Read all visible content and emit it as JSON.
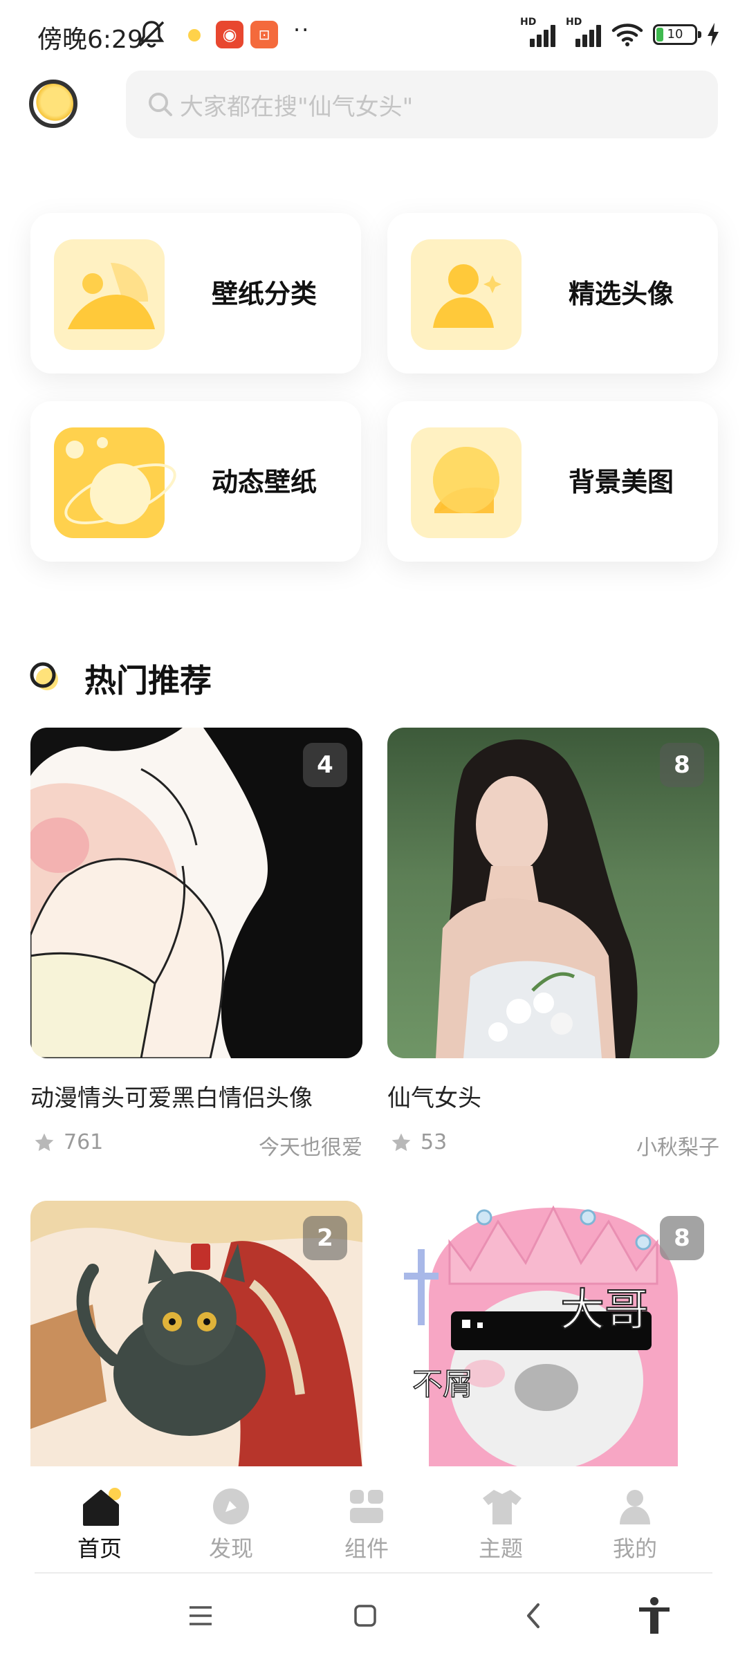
{
  "status_bar": {
    "time": "傍晚6:29",
    "dots": "··",
    "battery": "10",
    "signal_label_1": "HD",
    "signal_label_2": "HD"
  },
  "search": {
    "placeholder": "大家都在搜\"仙气女头\""
  },
  "quick_entries": [
    {
      "label": "壁纸分类",
      "icon": "landscape-icon"
    },
    {
      "label": "精选头像",
      "icon": "user-avatar-icon"
    },
    {
      "label": "动态壁纸",
      "icon": "planet-icon"
    },
    {
      "label": "背景美图",
      "icon": "chat-bubble-icon"
    }
  ],
  "section": {
    "title": "热门推荐"
  },
  "recommendations": [
    {
      "title": "动漫情头可爱黑白情侣头像",
      "count": "4",
      "likes": "761",
      "author": "今天也很爱"
    },
    {
      "title": "仙气女头",
      "count": "8",
      "likes": "53",
      "author": "小秋梨子"
    },
    {
      "title": "",
      "count": "2",
      "likes": "",
      "author": ""
    },
    {
      "title": "",
      "count": "8",
      "likes": "",
      "author": "",
      "overlay_text_1": "大哥",
      "overlay_text_2": "不屑"
    }
  ],
  "bottom_nav": [
    {
      "label": "首页",
      "icon": "home-icon",
      "active": true
    },
    {
      "label": "发现",
      "icon": "discover-icon",
      "active": false
    },
    {
      "label": "组件",
      "icon": "widgets-icon",
      "active": false
    },
    {
      "label": "主题",
      "icon": "tshirt-icon",
      "active": false
    },
    {
      "label": "我的",
      "icon": "profile-icon",
      "active": false
    }
  ],
  "colors": {
    "accent": "#ffd14d",
    "card_icon_bg": "#fff3c4",
    "text": "#111111",
    "muted": "#a6a6a6"
  }
}
